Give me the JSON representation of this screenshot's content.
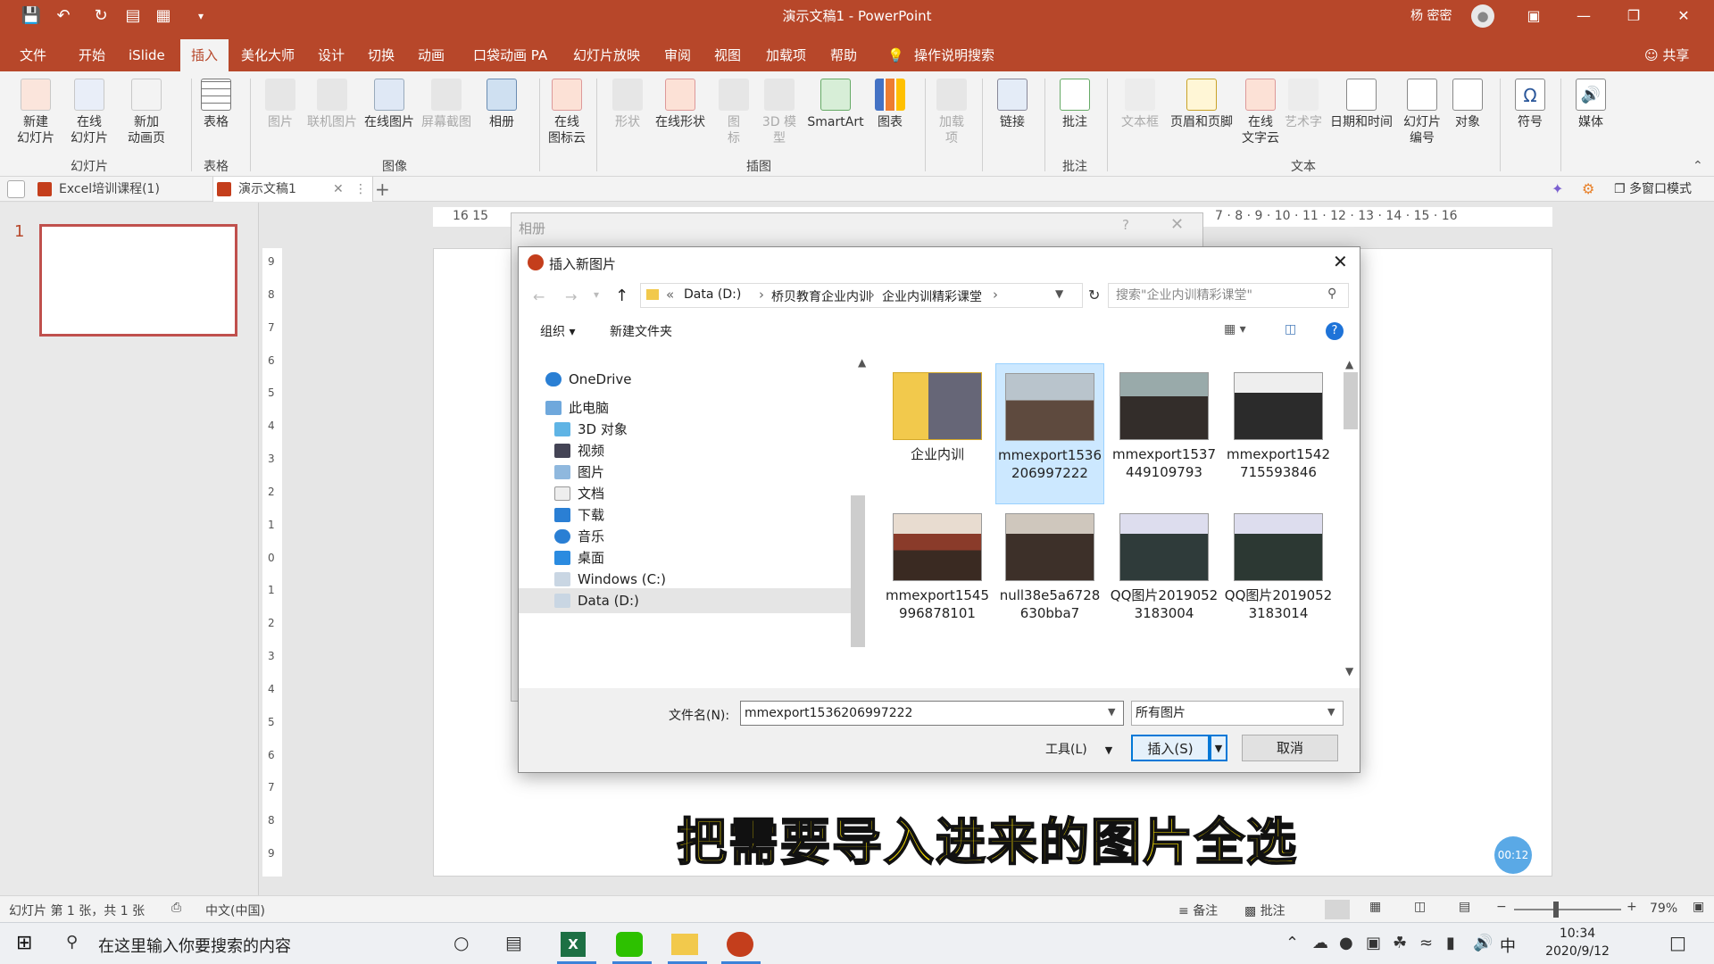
{
  "window": {
    "title": "演示文稿1  -  PowerPoint",
    "user": "杨 密密"
  },
  "quick_access": [
    "save-icon",
    "undo-icon",
    "redo-icon",
    "presenter-icon",
    "layout-icon",
    "more-icon"
  ],
  "ribbon_tabs": [
    "文件",
    "开始",
    "iSlide",
    "插入",
    "美化大师",
    "设计",
    "切换",
    "动画",
    "口袋动画 PA",
    "幻灯片放映",
    "审阅",
    "视图",
    "加载项",
    "帮助",
    "操作说明搜索"
  ],
  "active_tab": "插入",
  "share_label": "共享",
  "ribbon": {
    "groups": [
      "幻灯片",
      "表格",
      "图像",
      "插图",
      "批注",
      "文本"
    ],
    "buttons": {
      "new_slide": "新建\n幻灯片",
      "online_slide": "在线\n幻灯片",
      "new_anim_page": "新加\n动画页",
      "table": "表格",
      "picture": "图片",
      "online_picture_linked": "联机图片",
      "online_picture": "在线图片",
      "screenshot": "屏幕截图",
      "album": "相册",
      "online_icon": "在线\n图标云",
      "shape": "形状",
      "online_shape": "在线形状",
      "icon": "图\n标",
      "model3d": "3D 模\n型",
      "smartart": "SmartArt",
      "chart": "图表",
      "addin": "加载\n项",
      "link": "链接",
      "comment": "批注",
      "textbox": "文本框",
      "header_footer": "页眉和页脚",
      "online_text": "在线\n文字云",
      "wordart": "艺术字",
      "datetime": "日期和时间",
      "slide_number": "幻灯片\n编号",
      "object": "对象",
      "symbol": "符号",
      "media": "媒体"
    }
  },
  "doc_tabs": [
    "Excel培训课程(1)",
    "演示文稿1"
  ],
  "multi_window": "多窗口模式",
  "slide_thumb_number": "1",
  "hruler_text": "16   15",
  "hruler_right": "7 · 8 · 9 · 10 · 11 · 12 · 13 · 14 · 15 · 16",
  "vruler_numbers": [
    "9",
    "8",
    "7",
    "6",
    "5",
    "4",
    "3",
    "2",
    "1",
    "0",
    "1",
    "2",
    "3",
    "4",
    "5",
    "6",
    "7",
    "8",
    "9"
  ],
  "album_dialog": {
    "title": "相册",
    "help": "?"
  },
  "insert_dialog": {
    "title": "插入新图片",
    "breadcrumb": [
      "Data (D:)",
      "桥贝教育企业内训",
      "企业内训精彩课堂"
    ],
    "search_placeholder": "搜索\"企业内训精彩课堂\"",
    "organize": "组织",
    "new_folder": "新建文件夹",
    "tree": [
      {
        "label": "OneDrive",
        "icon": "onedrive-icon"
      },
      {
        "label": "此电脑",
        "icon": "computer-icon"
      },
      {
        "label": "3D 对象",
        "icon": "3d-icon"
      },
      {
        "label": "视频",
        "icon": "video-icon"
      },
      {
        "label": "图片",
        "icon": "pictures-icon"
      },
      {
        "label": "文档",
        "icon": "documents-icon"
      },
      {
        "label": "下载",
        "icon": "download-icon"
      },
      {
        "label": "音乐",
        "icon": "music-icon"
      },
      {
        "label": "桌面",
        "icon": "desktop-icon"
      },
      {
        "label": "Windows (C:)",
        "icon": "drive-icon"
      },
      {
        "label": "Data (D:)",
        "icon": "drive-icon"
      }
    ],
    "files": [
      {
        "name": "企业内训",
        "kind": "folder"
      },
      {
        "name": "mmexport1536206997222",
        "kind": "image",
        "selected": true
      },
      {
        "name": "mmexport1537449109793",
        "kind": "image"
      },
      {
        "name": "mmexport1542715593846",
        "kind": "image"
      },
      {
        "name": "mmexport1545996878101",
        "kind": "image"
      },
      {
        "name": "null38e5a6728630bba7",
        "kind": "image"
      },
      {
        "name": "QQ图片20190523183004",
        "kind": "image"
      },
      {
        "name": "QQ图片20190523183014",
        "kind": "image"
      }
    ],
    "filename_label": "文件名(N):",
    "filename_value": "mmexport1536206997222",
    "filetype": "所有图片",
    "tools": "工具(L)",
    "insert": "插入(S)",
    "cancel": "取消"
  },
  "subtitle": "把需要导入进来的图片全选",
  "timer_badge": "00:12",
  "status": {
    "slide_info": "幻灯片 第 1 张，共 1 张",
    "language": "中文(中国)",
    "notes": "备注",
    "comments": "批注",
    "zoom": "79%"
  },
  "taskbar": {
    "search_placeholder": "在这里输入你要搜索的内容",
    "ime": "中",
    "time": "10:34",
    "date": "2020/9/12"
  }
}
